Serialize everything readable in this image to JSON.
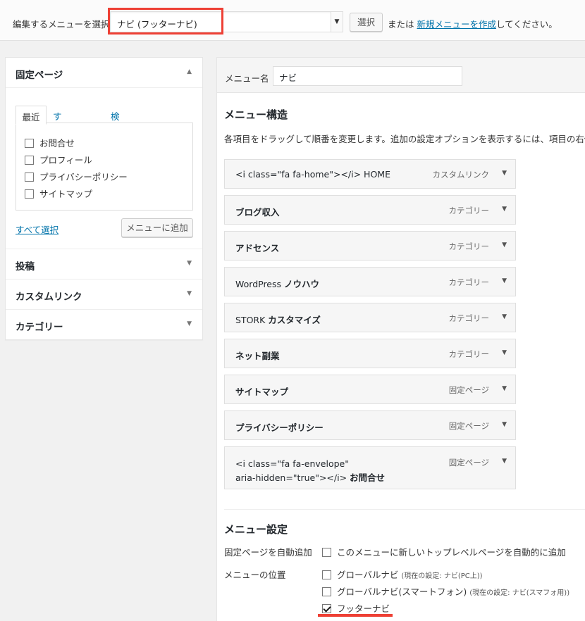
{
  "topbar": {
    "label": "編集するメニューを選択:",
    "selected_menu": "ナビ (フッターナビ)",
    "select_button": "選択",
    "or_text": "または",
    "create_link": "新規メニューを作成",
    "suffix_text": "してください。"
  },
  "left_panel": {
    "pages_section": {
      "title": "固定ページ",
      "tabs": [
        "最近",
        "すべて表示",
        "検索"
      ],
      "items": [
        "お問合せ",
        "プロフィール",
        "プライバシーポリシー",
        "サイトマップ"
      ],
      "select_all": "すべて選択",
      "add_button": "メニューに追加"
    },
    "collapsed_sections": [
      "投稿",
      "カスタムリンク",
      "カテゴリー"
    ]
  },
  "right_panel": {
    "menu_name_label": "メニュー名",
    "menu_name_value": "ナビ",
    "structure_heading": "メニュー構造",
    "structure_desc": "各項目をドラッグして順番を変更します。追加の設定オプションを表示するには、項目の右側にあ",
    "items": [
      {
        "prefix": "<i class=\"fa fa-home\"></i> HOME",
        "bold": "",
        "type": "カスタムリンク"
      },
      {
        "prefix": "",
        "bold": "ブログ収入",
        "type": "カテゴリー"
      },
      {
        "prefix": "",
        "bold": "アドセンス",
        "type": "カテゴリー"
      },
      {
        "prefix": "WordPress ",
        "bold": "ノウハウ",
        "type": "カテゴリー"
      },
      {
        "prefix": "STORK ",
        "bold": "カスタマイズ",
        "type": "カテゴリー"
      },
      {
        "prefix": "",
        "bold": "ネット副業",
        "type": "カテゴリー"
      },
      {
        "prefix": "",
        "bold": "サイトマップ",
        "type": "固定ページ"
      },
      {
        "prefix": "",
        "bold": "プライバシーポリシー",
        "type": "固定ページ"
      }
    ],
    "last_item": {
      "line1": "<i class=\"fa fa-envelope\"",
      "line2": "aria-hidden=\"true\"></i> ",
      "bold": "お問合せ",
      "type": "固定ページ"
    },
    "settings_heading": "メニュー設定",
    "auto_add_label": "固定ページを自動追加",
    "auto_add_option": "このメニューに新しいトップレベルページを自動的に追加",
    "location_label": "メニューの位置",
    "locations": [
      {
        "name": "グローバルナビ",
        "note": "(現在の設定: ナビ(PC上))",
        "checked": false
      },
      {
        "name": "グローバルナビ(スマートフォン)",
        "note": "(現在の設定: ナビ(スマフォ用))",
        "checked": false
      },
      {
        "name": "フッターナビ",
        "note": "",
        "checked": true
      }
    ]
  },
  "icons": {
    "dropdown": "chevron-down-icon",
    "collapse": "triangle-up-icon",
    "expand": "triangle-down-icon",
    "checkbox": "checkbox-icon"
  },
  "colors": {
    "highlight": "#ee4035",
    "link": "#0073aa"
  }
}
